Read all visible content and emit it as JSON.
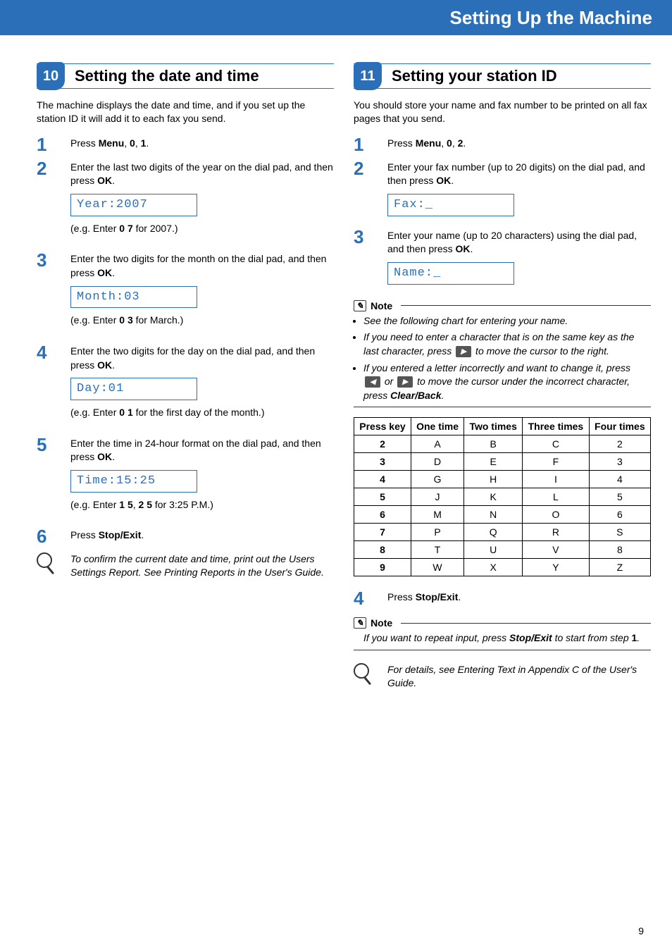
{
  "header": {
    "title": "Setting Up the Machine"
  },
  "left": {
    "badge": "10",
    "title": "Setting the date and time",
    "intro": "The machine displays the date and time, and if you set up the station ID it will add it to each fax you send.",
    "s1": {
      "pre": "Press ",
      "b1": "Menu",
      "mid1": ", ",
      "b2": "0",
      "mid2": ", ",
      "b3": "1",
      "post": "."
    },
    "s2": {
      "text1": "Enter the last two digits of the year on the dial pad, and then press ",
      "b1": "OK",
      "text2": ".",
      "lcd": "Year:2007",
      "eg_pre": "(e.g. Enter ",
      "eg_b": "0 7",
      "eg_post": " for 2007.)"
    },
    "s3": {
      "text1": "Enter the two digits for the month on the dial pad, and then press ",
      "b1": "OK",
      "text2": ".",
      "lcd": "Month:03",
      "eg_pre": "(e.g. Enter ",
      "eg_b": "0 3",
      "eg_post": " for March.)"
    },
    "s4": {
      "text1": "Enter the two digits for the day on the dial pad, and then press ",
      "b1": "OK",
      "text2": ".",
      "lcd": "Day:01",
      "eg_pre": "(e.g. Enter ",
      "eg_b": "0 1",
      "eg_post": " for the first day of the month.)"
    },
    "s5": {
      "text1": "Enter the time in 24-hour format on the dial pad, and then press ",
      "b1": "OK",
      "text2": ".",
      "lcd": "Time:15:25",
      "eg_pre": "(e.g. Enter ",
      "eg_b1": "1 5",
      "eg_mid": ", ",
      "eg_b2": "2 5",
      "eg_post": " for 3:25 P.M.)"
    },
    "s6": {
      "pre": "Press ",
      "b1": "Stop/Exit",
      "post": "."
    },
    "tip": "To confirm the current date and time, print out the Users Settings Report. See Printing Reports in the User's Guide."
  },
  "right": {
    "badge": "11",
    "title": "Setting your station ID",
    "intro": "You should store your name and fax number to be printed on all fax pages that you send.",
    "s1": {
      "pre": "Press ",
      "b1": "Menu",
      "mid1": ", ",
      "b2": "0",
      "mid2": ", ",
      "b3": "2",
      "post": "."
    },
    "s2": {
      "text1": "Enter your fax number (up to 20 digits) on the dial pad, and then press ",
      "b1": "OK",
      "text2": ".",
      "lcd": "Fax:_"
    },
    "s3": {
      "text1": "Enter your name (up to 20 characters) using the dial pad, and then press ",
      "b1": "OK",
      "text2": ".",
      "lcd": "Name:_"
    },
    "note1": {
      "label": "Note",
      "li1": "See the following chart for entering your name.",
      "li2a": "If you need to enter a character that is on the same key as the last character, press ",
      "li2b": " to move the cursor to the right.",
      "li3a": "If you entered a letter incorrectly and want to change it, press ",
      "li3b": " or ",
      "li3c": " to move the cursor under the incorrect character, press ",
      "li3d": "Clear/Back",
      "li3e": "."
    },
    "table": {
      "headers": [
        "Press key",
        "One time",
        "Two times",
        "Three times",
        "Four times"
      ],
      "rows": [
        [
          "2",
          "A",
          "B",
          "C",
          "2"
        ],
        [
          "3",
          "D",
          "E",
          "F",
          "3"
        ],
        [
          "4",
          "G",
          "H",
          "I",
          "4"
        ],
        [
          "5",
          "J",
          "K",
          "L",
          "5"
        ],
        [
          "6",
          "M",
          "N",
          "O",
          "6"
        ],
        [
          "7",
          "P",
          "Q",
          "R",
          "S"
        ],
        [
          "8",
          "T",
          "U",
          "V",
          "8"
        ],
        [
          "9",
          "W",
          "X",
          "Y",
          "Z"
        ]
      ]
    },
    "s4": {
      "pre": "Press ",
      "b1": "Stop/Exit",
      "post": "."
    },
    "note2": {
      "label": "Note",
      "text_a": "If you want to repeat input, press ",
      "text_b": "Stop/Exit",
      "text_c": " to start from step ",
      "text_d": "1",
      "text_e": "."
    },
    "tip": "For details, see Entering Text in Appendix C of the User's Guide."
  },
  "page_number": "9"
}
